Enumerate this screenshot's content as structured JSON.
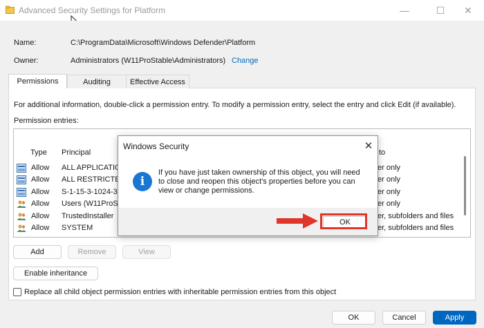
{
  "window": {
    "title": "Advanced Security Settings for Platform",
    "minimize": "—",
    "maximize": "☐",
    "close": "✕"
  },
  "details": {
    "name_label": "Name:",
    "name_value": "C:\\ProgramData\\Microsoft\\Windows Defender\\Platform",
    "owner_label": "Owner:",
    "owner_value": "Administrators (W11ProStable\\Administrators)",
    "owner_change": "Change"
  },
  "tabs": [
    {
      "label": "Permissions"
    },
    {
      "label": "Auditing"
    },
    {
      "label": "Effective Access"
    }
  ],
  "permissions": {
    "info": "For additional information, double-click a permission entry. To modify a permission entry, select the entry and click Edit (if available).",
    "entries_label": "Permission entries:",
    "columns": {
      "type": "Type",
      "principal": "Principal",
      "applies": "to"
    },
    "rows": [
      {
        "type": "Allow",
        "principal": "ALL APPLICATION",
        "applies": "er only",
        "icon": "app-package-icon"
      },
      {
        "type": "Allow",
        "principal": "ALL RESTRICTED",
        "applies": "er only",
        "icon": "app-package-icon"
      },
      {
        "type": "Allow",
        "principal": "S-1-15-3-1024-31",
        "applies": "er only",
        "icon": "app-package-icon"
      },
      {
        "type": "Allow",
        "principal": "Users (W11ProSta",
        "applies": "er only",
        "icon": "users-icon"
      },
      {
        "type": "Allow",
        "principal": "TrustedInstaller",
        "applies": "er, subfolders and files",
        "icon": "users-icon"
      },
      {
        "type": "Allow",
        "principal": "SYSTEM",
        "applies": "er, subfolders and files",
        "icon": "users-icon"
      }
    ],
    "add_label": "Add",
    "remove_label": "Remove",
    "view_label": "View",
    "enable_inheritance_label": "Enable inheritance",
    "replace_label": "Replace all child object permission entries with inheritable permission entries from this object"
  },
  "footer": {
    "ok_label": "OK",
    "cancel_label": "Cancel",
    "apply_label": "Apply"
  },
  "dialog": {
    "title": "Windows Security",
    "close": "✕",
    "message": "If you have just taken ownership of this object, you will need to close and reopen this object's properties before you can view or change permissions.",
    "ok_label": "OK",
    "info_glyph": "i"
  },
  "colors": {
    "accent": "#0067c0",
    "highlight": "#e0352b"
  }
}
